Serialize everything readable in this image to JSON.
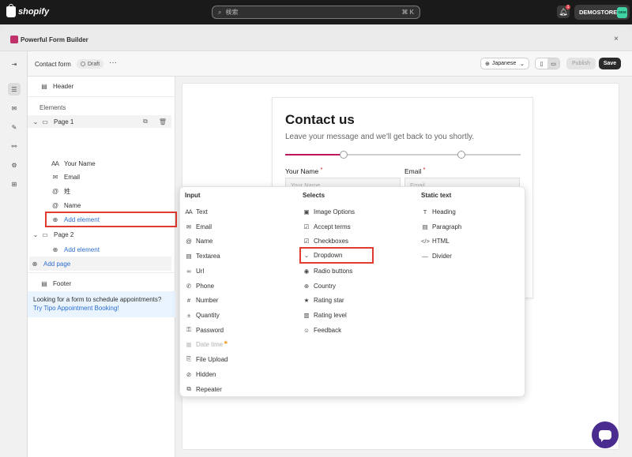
{
  "topbar": {
    "brand": "shopify",
    "search_placeholder": "検索",
    "search_shortcut": "⌘ K",
    "notification_count": "1",
    "store_name": "DEMOSTORE",
    "store_avatar": "DEM"
  },
  "app": {
    "title": "Powerful Form Builder",
    "close": "×"
  },
  "toolbar": {
    "form_name": "Contact form",
    "status": "Draft",
    "more": "···",
    "language": "Japanese",
    "publish_label": "Publish",
    "save_label": "Save"
  },
  "sidebar": {
    "header": "Header",
    "elements_label": "Elements",
    "page1": "Page 1",
    "page1_items": [
      "Your Name",
      "Email",
      "姓",
      "Name"
    ],
    "add_element": "Add element",
    "page2": "Page 2",
    "add_element_2": "Add element",
    "add_page": "Add page",
    "footer": "Footer",
    "promo_text": "Looking for a form to schedule appointments? ",
    "promo_link": "Try Tipo Appointment Booking!"
  },
  "preview": {
    "title": "Contact us",
    "subtitle": "Leave your message and we'll get back to you shortly.",
    "progress_fraction": 0.25,
    "field1_label": "Your Name",
    "field1_placeholder": "Your Name",
    "field2_label": "Email",
    "field2_placeholder": "Email",
    "required_mark": "*"
  },
  "popover": {
    "input_header": "Input",
    "selects_header": "Selects",
    "static_header": "Static text",
    "input_items": [
      "Text",
      "Email",
      "Name",
      "Textarea",
      "Url",
      "Phone",
      "Number",
      "Quantity",
      "Password",
      "Date time",
      "File Upload",
      "Hidden",
      "Repeater"
    ],
    "select_items": [
      "Image Options",
      "Accept terms",
      "Checkboxes",
      "Dropdown",
      "Radio buttons",
      "Country",
      "Rating star",
      "Rating level",
      "Feedback"
    ],
    "static_items": [
      "Heading",
      "Paragraph",
      "HTML",
      "Divider"
    ],
    "pro_mark": "✱"
  },
  "colors": {
    "accent": "#c2185b",
    "link": "#2c6ecb",
    "highlight": "#e03b2f",
    "chat": "#4a2b8f"
  }
}
